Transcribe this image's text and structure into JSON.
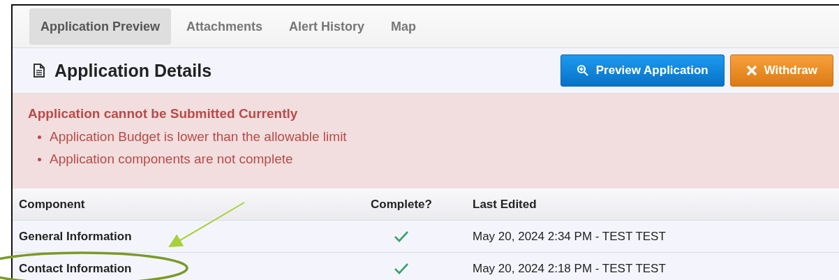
{
  "tabs": [
    {
      "label": "Application Preview",
      "selected": true
    },
    {
      "label": "Attachments",
      "selected": false
    },
    {
      "label": "Alert History",
      "selected": false
    },
    {
      "label": "Map",
      "selected": false
    }
  ],
  "header": {
    "title": "Application Details",
    "buttons": [
      {
        "label": "Preview Application",
        "kind": "preview"
      },
      {
        "label": "Withdraw",
        "kind": "withdraw"
      }
    ]
  },
  "alert": {
    "title": "Application cannot be Submitted Currently",
    "items": [
      "Application Budget is lower than the allowable limit",
      "Application components are not complete"
    ]
  },
  "table": {
    "columns": [
      "Component",
      "Complete?",
      "Last Edited"
    ],
    "rows": [
      {
        "component": "General Information",
        "complete": true,
        "last_edited": "May 20, 2024 2:34 PM - TEST TEST"
      },
      {
        "component": "Contact Information",
        "complete": true,
        "last_edited": "May 20, 2024 2:18 PM - TEST TEST"
      }
    ]
  }
}
